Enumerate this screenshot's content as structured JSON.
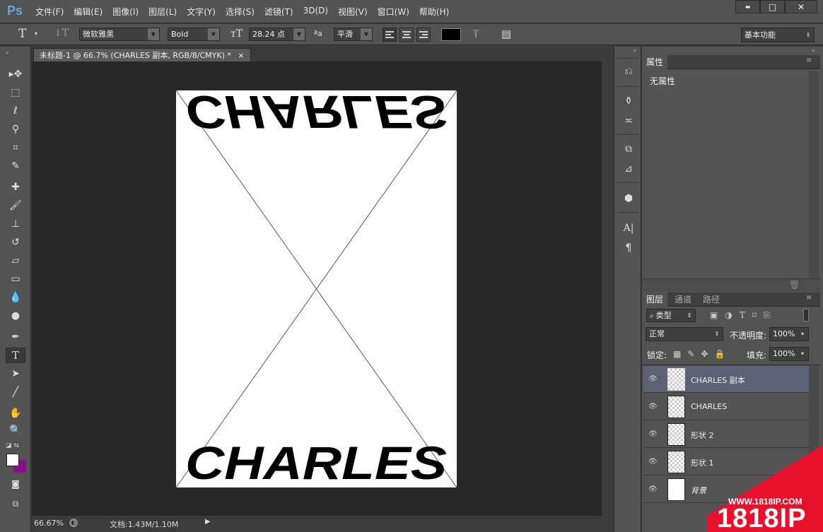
{
  "app": {
    "logo": "Ps"
  },
  "menu": [
    "文件(F)",
    "编辑(E)",
    "图像(I)",
    "图层(L)",
    "文字(Y)",
    "选择(S)",
    "滤镜(T)",
    "3D(D)",
    "视图(V)",
    "窗口(W)",
    "帮助(H)"
  ],
  "window_buttons": {
    "minimize": "▬",
    "maximize": "□",
    "close": "✕"
  },
  "options": {
    "font_family": "微软雅黑",
    "font_style": "Bold",
    "font_size": "28.24 点",
    "antialias": "平滑",
    "aa_label": "ªa",
    "workspace": "基本功能",
    "text_color": "#000000"
  },
  "document": {
    "tab_title": "未标题-1 @ 66.7% (CHARLES 副本, RGB/8/CMYK) *",
    "tab_close": "×",
    "text_top": "CHARLES",
    "text_bottom": "CHARLES"
  },
  "status": {
    "zoom": "66.67%",
    "doc_info": "文档:1.43M/1.10M"
  },
  "properties": {
    "tab": "属性",
    "content": "无属性"
  },
  "layers_panel": {
    "tabs": [
      "图层",
      "通道",
      "路径"
    ],
    "filter_kind": "类型",
    "blend_mode": "正常",
    "opacity_label": "不透明度:",
    "opacity": "100%",
    "lock_label": "锁定:",
    "fill_label": "填充:",
    "fill": "100%",
    "layers": [
      {
        "name": "CHARLES 副本",
        "selected": true
      },
      {
        "name": "CHARLES",
        "selected": false
      },
      {
        "name": "形状 2",
        "selected": false
      },
      {
        "name": "形状 1",
        "selected": false
      },
      {
        "name": "背景",
        "selected": false
      }
    ]
  },
  "colors": {
    "foreground": "#ffffff",
    "background": "#8b0d8b",
    "selection": "#5a6275",
    "watermark": "#e8112d"
  },
  "watermark": {
    "url": "WWW.1818IP.COM",
    "brand": "1818IP"
  }
}
